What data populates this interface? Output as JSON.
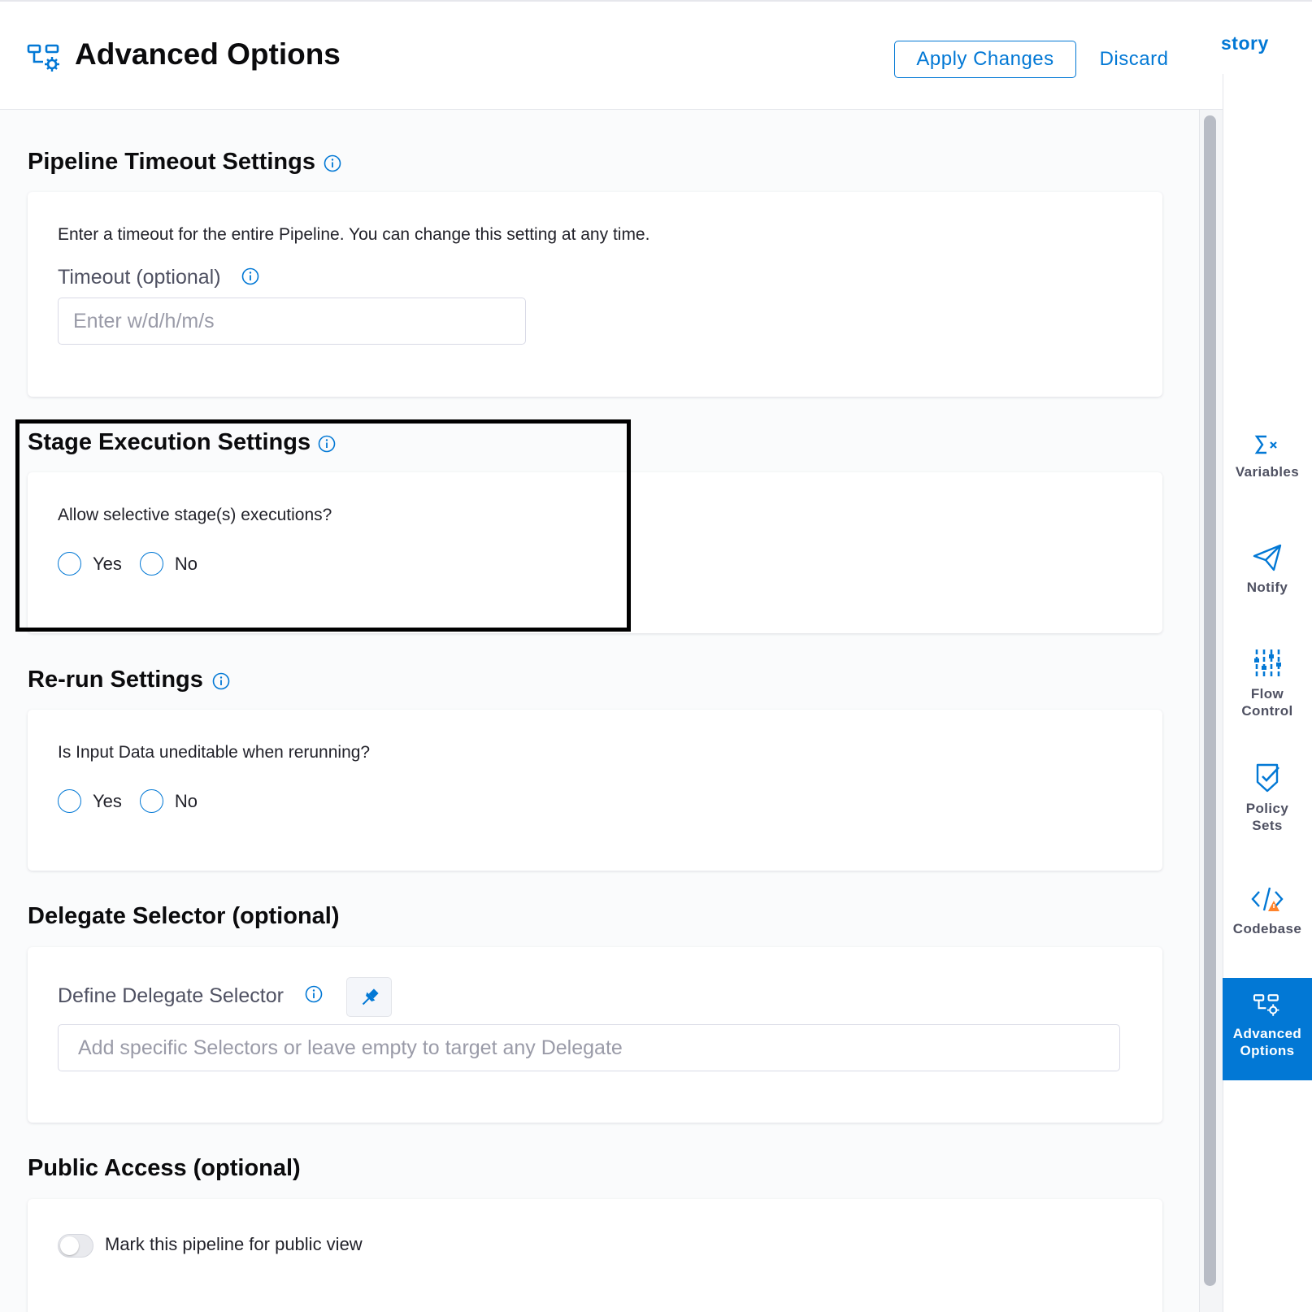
{
  "header": {
    "title": "Advanced Options",
    "apply_label": "Apply Changes",
    "discard_label": "Discard",
    "history_label": "story"
  },
  "timeout_section": {
    "title": "Pipeline Timeout Settings",
    "description": "Enter a timeout for the entire Pipeline. You can change this setting at any time.",
    "field_label": "Timeout (optional)",
    "placeholder": "Enter w/d/h/m/s",
    "value": ""
  },
  "stage_section": {
    "title": "Stage Execution Settings",
    "question": "Allow selective stage(s) executions?",
    "options": [
      "Yes",
      "No"
    ]
  },
  "rerun_section": {
    "title": "Re-run Settings",
    "question": "Is Input Data uneditable when rerunning?",
    "options": [
      "Yes",
      "No"
    ]
  },
  "delegate_section": {
    "title": "Delegate Selector (optional)",
    "field_label": "Define Delegate Selector",
    "placeholder": "Add specific Selectors or leave empty to target any Delegate"
  },
  "public_section": {
    "title": "Public Access (optional)",
    "toggle_label": "Mark this pipeline for public view",
    "toggle_on": false
  },
  "right_nav": {
    "items": [
      {
        "label": "Variables",
        "icon": "variables-icon"
      },
      {
        "label": "Notify",
        "icon": "paper-plane-icon"
      },
      {
        "label": "Flow Control",
        "icon": "sliders-icon"
      },
      {
        "label": "Policy Sets",
        "icon": "shield-check-icon"
      },
      {
        "label": "Codebase",
        "icon": "code-warning-icon"
      },
      {
        "label": "Advanced Options",
        "icon": "advanced-options-icon",
        "active": true
      }
    ]
  },
  "colors": {
    "accent": "#0278d5",
    "text": "#0b0b0d",
    "muted": "#4f5162",
    "warning": "#ff832b"
  }
}
